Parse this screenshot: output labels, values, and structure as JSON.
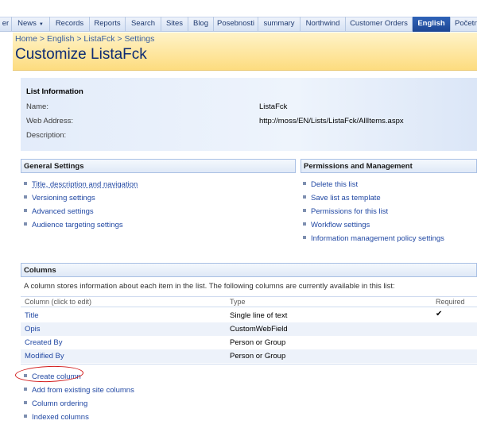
{
  "nav": {
    "tabs": [
      {
        "label": "er"
      },
      {
        "label": "News"
      },
      {
        "label": "Records"
      },
      {
        "label": "Reports"
      },
      {
        "label": "Search"
      },
      {
        "label": "Sites"
      },
      {
        "label": "Blog"
      },
      {
        "label": "Posebnosti"
      },
      {
        "label": "summary"
      },
      {
        "label": "Northwind"
      },
      {
        "label": "Customer Orders"
      },
      {
        "label": "English"
      },
      {
        "label": "Početn"
      }
    ],
    "selected": "English"
  },
  "header": {
    "breadcrumb": "Home > English > ListaFck > Settings",
    "title": "Customize ListaFck"
  },
  "list_info": {
    "title": "List Information",
    "name_label": "Name:",
    "name_value": "ListaFck",
    "web_label": "Web Address:",
    "web_value": "http://moss/EN/Lists/ListaFck/AllItems.aspx",
    "desc_label": "Description:"
  },
  "general_settings": {
    "title": "General Settings",
    "links": [
      "Title, description and navigation",
      "Versioning settings",
      "Advanced settings",
      "Audience targeting settings"
    ]
  },
  "permissions": {
    "title": "Permissions and Management",
    "links": [
      "Delete this list",
      "Save list as template",
      "Permissions for this list",
      "Workflow settings",
      "Information management policy settings"
    ]
  },
  "columns": {
    "title": "Columns",
    "description": "A column stores information about each item in the list. The following columns are currently available in this list:",
    "headers": [
      "Column (click to edit)",
      "Type",
      "Required"
    ],
    "rows": [
      {
        "name": "Title",
        "type": "Single line of text",
        "required": true
      },
      {
        "name": "Opis",
        "type": "CustomWebField",
        "required": false
      },
      {
        "name": "Created By",
        "type": "Person or Group",
        "required": false
      },
      {
        "name": "Modified By",
        "type": "Person or Group",
        "required": false
      }
    ],
    "actions": [
      "Create column",
      "Add from existing site columns",
      "Column ordering",
      "Indexed columns"
    ]
  },
  "colors": {
    "link": "#2148a3",
    "title": "#0d2b73",
    "selected_tab": "#1d4694",
    "highlight_circle": "#d21c1c"
  },
  "icons": {
    "checkmark": "check-icon",
    "bullet": "square-bullet-icon"
  }
}
